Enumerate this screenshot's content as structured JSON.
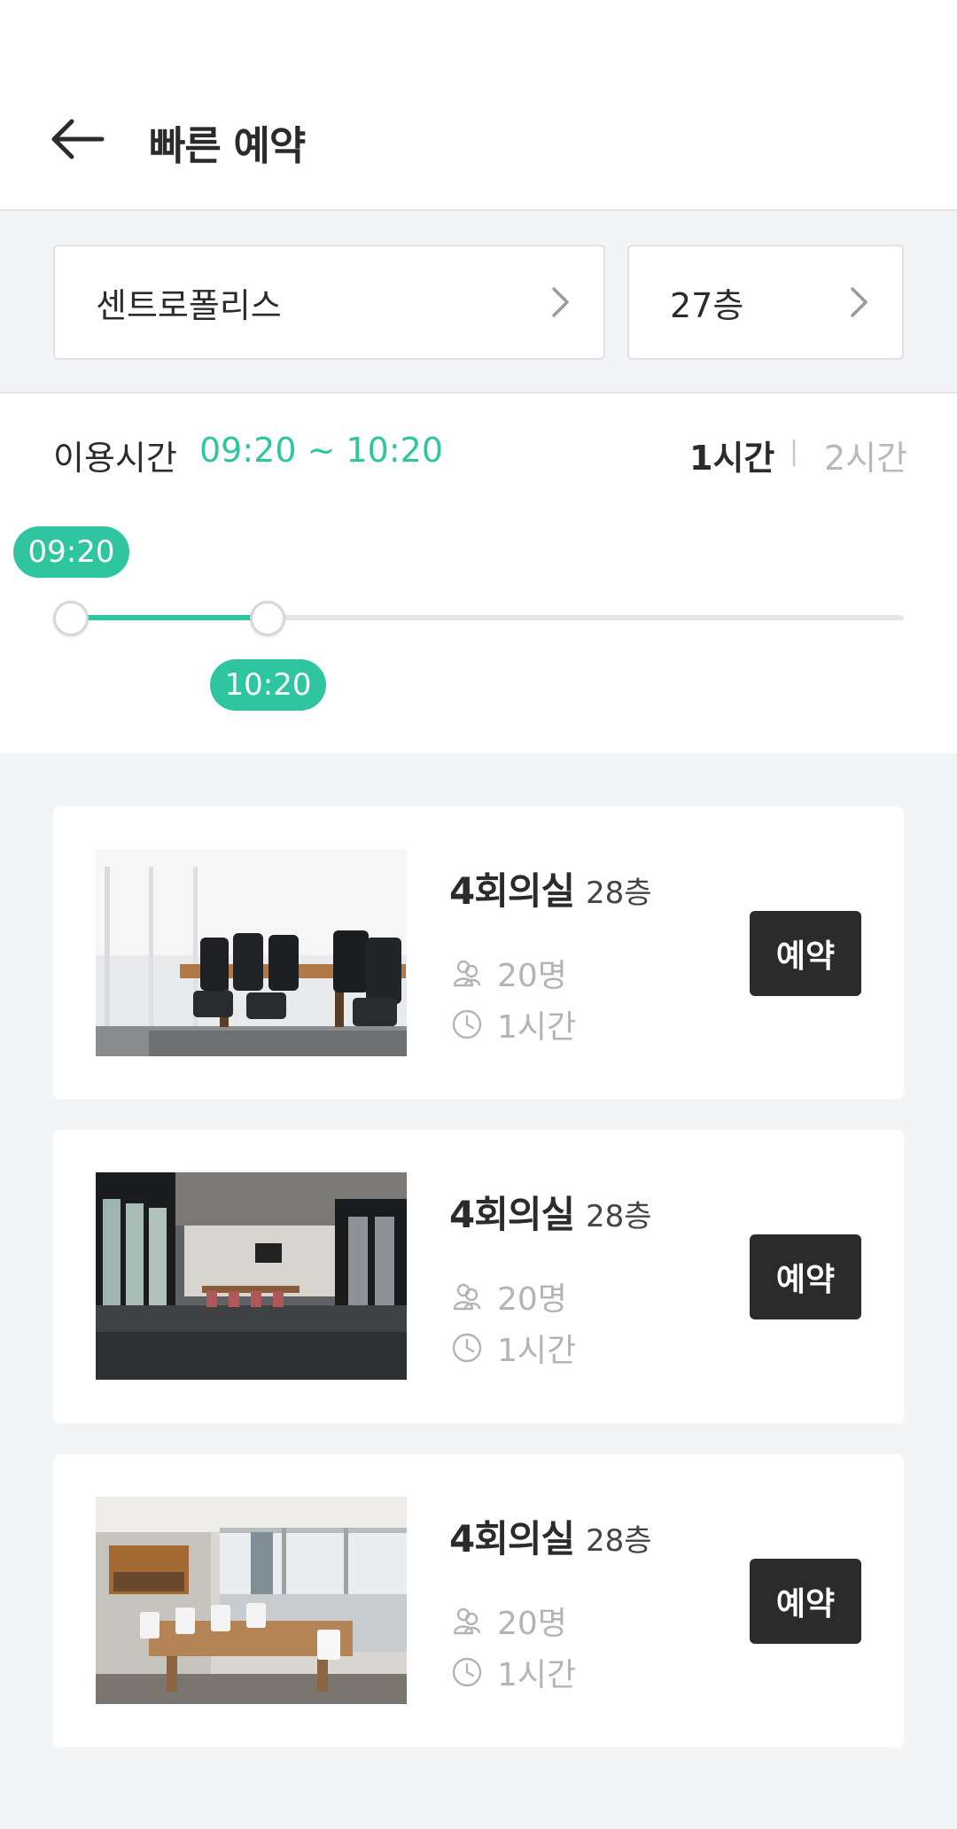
{
  "header": {
    "title": "빠른 예약",
    "back_icon": "arrow-left-icon"
  },
  "selectors": {
    "building": {
      "label": "센트로폴리스",
      "icon": "chevron-right-icon"
    },
    "floor": {
      "label": "27층",
      "icon": "chevron-right-icon"
    }
  },
  "time": {
    "label": "이용시간",
    "range": "09:20 ~ 10:20",
    "durations": [
      {
        "label": "1시간",
        "selected": true
      },
      {
        "label": "2시간",
        "selected": false
      }
    ],
    "separator": "|",
    "slider": {
      "start": "09:20",
      "end": "10:20"
    }
  },
  "rooms": [
    {
      "name": "4회의실",
      "floor": "28층",
      "capacity": "20명",
      "duration": "1시간",
      "button": "예약"
    },
    {
      "name": "4회의실",
      "floor": "28층",
      "capacity": "20명",
      "duration": "1시간",
      "button": "예약"
    },
    {
      "name": "4회의실",
      "floor": "28층",
      "capacity": "20명",
      "duration": "1시간",
      "button": "예약"
    }
  ],
  "colors": {
    "accent": "#2fc5a0",
    "button": "#2b2b2b",
    "background": "#f3f4f6"
  }
}
